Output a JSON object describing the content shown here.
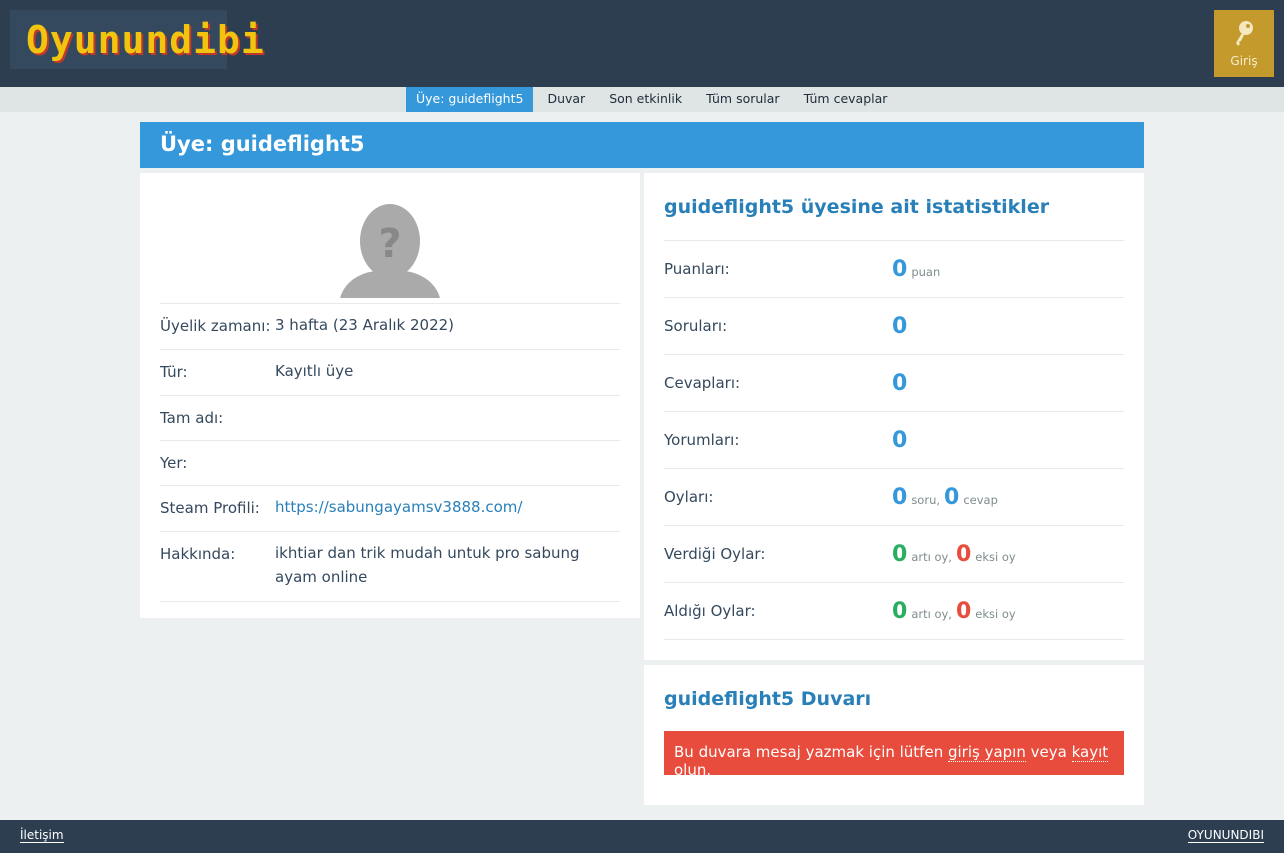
{
  "header": {
    "logo_text": "Oyunundibi",
    "login_label": "Giriş"
  },
  "nav": {
    "items": [
      {
        "label": "Üye: guideflight5"
      },
      {
        "label": "Duvar"
      },
      {
        "label": "Son etkinlik"
      },
      {
        "label": "Tüm sorular"
      },
      {
        "label": "Tüm cevaplar"
      }
    ]
  },
  "page": {
    "title": "Üye: guideflight5"
  },
  "profile": {
    "rows": [
      {
        "label": "Üyelik zamanı:",
        "value": "3 hafta (23 Aralık 2022)"
      },
      {
        "label": "Tür:",
        "value": "Kayıtlı üye"
      },
      {
        "label": "Tam adı:",
        "value": ""
      },
      {
        "label": "Yer:",
        "value": ""
      },
      {
        "label": "Steam Profili:",
        "value": "https://sabungayamsv3888.com/"
      },
      {
        "label": "Hakkında:",
        "value": "ikhtiar dan trik mudah untuk pro sabung ayam online"
      }
    ]
  },
  "stats": {
    "title": "guideflight5 üyesine ait istatistikler",
    "points": {
      "label": "Puanları:",
      "value": "0",
      "unit": "puan"
    },
    "questions": {
      "label": "Soruları:",
      "value": "0"
    },
    "answers": {
      "label": "Cevapları:",
      "value": "0"
    },
    "comments": {
      "label": "Yorumları:",
      "value": "0"
    },
    "votes": {
      "label": "Oyları:",
      "q_value": "0",
      "q_unit": "soru,",
      "a_value": "0",
      "a_unit": "cevap"
    },
    "given": {
      "label": "Verdiği Oylar:",
      "up": "0",
      "up_unit": "artı oy,",
      "down": "0",
      "down_unit": "eksi oy"
    },
    "received": {
      "label": "Aldığı Oylar:",
      "up": "0",
      "up_unit": "artı oy,",
      "down": "0",
      "down_unit": "eksi oy"
    }
  },
  "wall": {
    "title": "guideflight5 Duvarı",
    "msg_prefix": "Bu duvara mesaj yazmak için lütfen ",
    "login_link": "giriş yapın",
    "msg_middle": " veya ",
    "register_link": "kayıt olun",
    "msg_suffix": "."
  },
  "footer": {
    "contact": "İletişim",
    "site_name": "OYUNUNDIBI"
  },
  "colors": {
    "header_bg": "#2c3e50",
    "accent": "#3498db",
    "link": "#2980b9",
    "positive": "#27ae60",
    "negative": "#e74c3c",
    "login_button": "#c49a2c"
  }
}
